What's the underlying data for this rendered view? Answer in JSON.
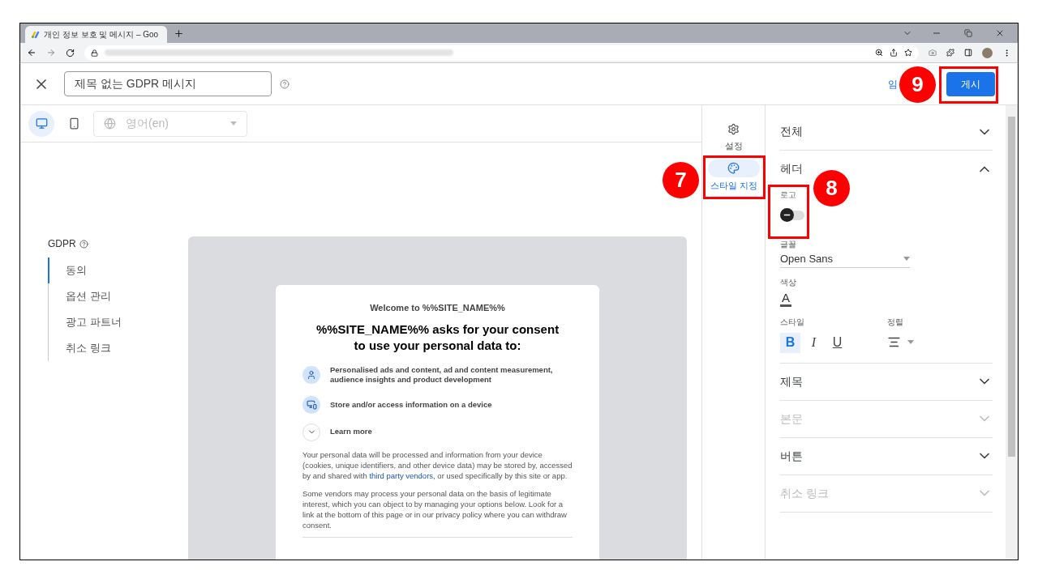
{
  "browser": {
    "tab_title": "개인 정보 보호 및 메시지 – Goo"
  },
  "header": {
    "title_value": "제목 없는 GDPR 메시지",
    "draft_button": "임",
    "publish_button": "게시"
  },
  "toolbar": {
    "devices": [
      {
        "kind": "desktop",
        "selected": true
      },
      {
        "kind": "mobile",
        "selected": false
      }
    ],
    "language": {
      "value": "영어(en)",
      "disabled": true
    }
  },
  "nav": {
    "title": "GDPR",
    "items": [
      {
        "label": "동의",
        "selected": true
      },
      {
        "label": "옵션 관리",
        "selected": false
      },
      {
        "label": "광고 파트너",
        "selected": false
      },
      {
        "label": "취소 링크",
        "selected": false
      }
    ]
  },
  "preview": {
    "welcome": "Welcome to %%SITE_NAME%%",
    "heading": "%%SITE_NAME%% asks for your consent to use your personal data to:",
    "purposes": [
      {
        "kind": "person",
        "text": "Personalised ads and content, ad and content measurement, audience insights and product development"
      },
      {
        "kind": "device",
        "text": "Store and/or access information on a device"
      }
    ],
    "learn_more": "Learn more",
    "paragraph_1": {
      "before": "Your personal data will be processed and information from your device (cookies, unique identifiers, and other device data) may be stored by, accessed by and shared with ",
      "link": "third party vendors",
      "after": ", or used specifically by this site or app."
    },
    "paragraph_2": "Some vendors may process your personal data on the basis of legitimate interest, which you can object to by managing your options below. Look for a link at the bottom of this page or in our privacy policy where you can withdraw consent."
  },
  "rail": [
    {
      "kind": "settings",
      "label": "설정",
      "selected": false
    },
    {
      "kind": "style",
      "label": "스타일 지정",
      "selected": true
    }
  ],
  "panel": {
    "sections": [
      {
        "title": "전체",
        "expanded": false,
        "disabled": false
      },
      {
        "title": "헤더",
        "expanded": true,
        "disabled": false
      },
      {
        "title": "제목",
        "expanded": false,
        "disabled": false
      },
      {
        "title": "본문",
        "expanded": false,
        "disabled": true
      },
      {
        "title": "버튼",
        "expanded": false,
        "disabled": false
      },
      {
        "title": "취소 링크",
        "expanded": false,
        "disabled": true
      }
    ],
    "header_settings": {
      "logo_label": "로고",
      "logo_on": false,
      "font_label": "글꼴",
      "font_value": "Open Sans",
      "color_label": "색상",
      "color_glyph": "A",
      "style_label": "스타일",
      "styles": [
        {
          "glyph": "B",
          "kind": "bold",
          "selected": true
        },
        {
          "glyph": "I",
          "kind": "italic",
          "selected": false
        },
        {
          "glyph": "U",
          "kind": "underline",
          "selected": false
        }
      ],
      "align_label": "정렬"
    }
  },
  "annotations": [
    {
      "label": "7"
    },
    {
      "label": "8"
    },
    {
      "label": "9"
    }
  ]
}
